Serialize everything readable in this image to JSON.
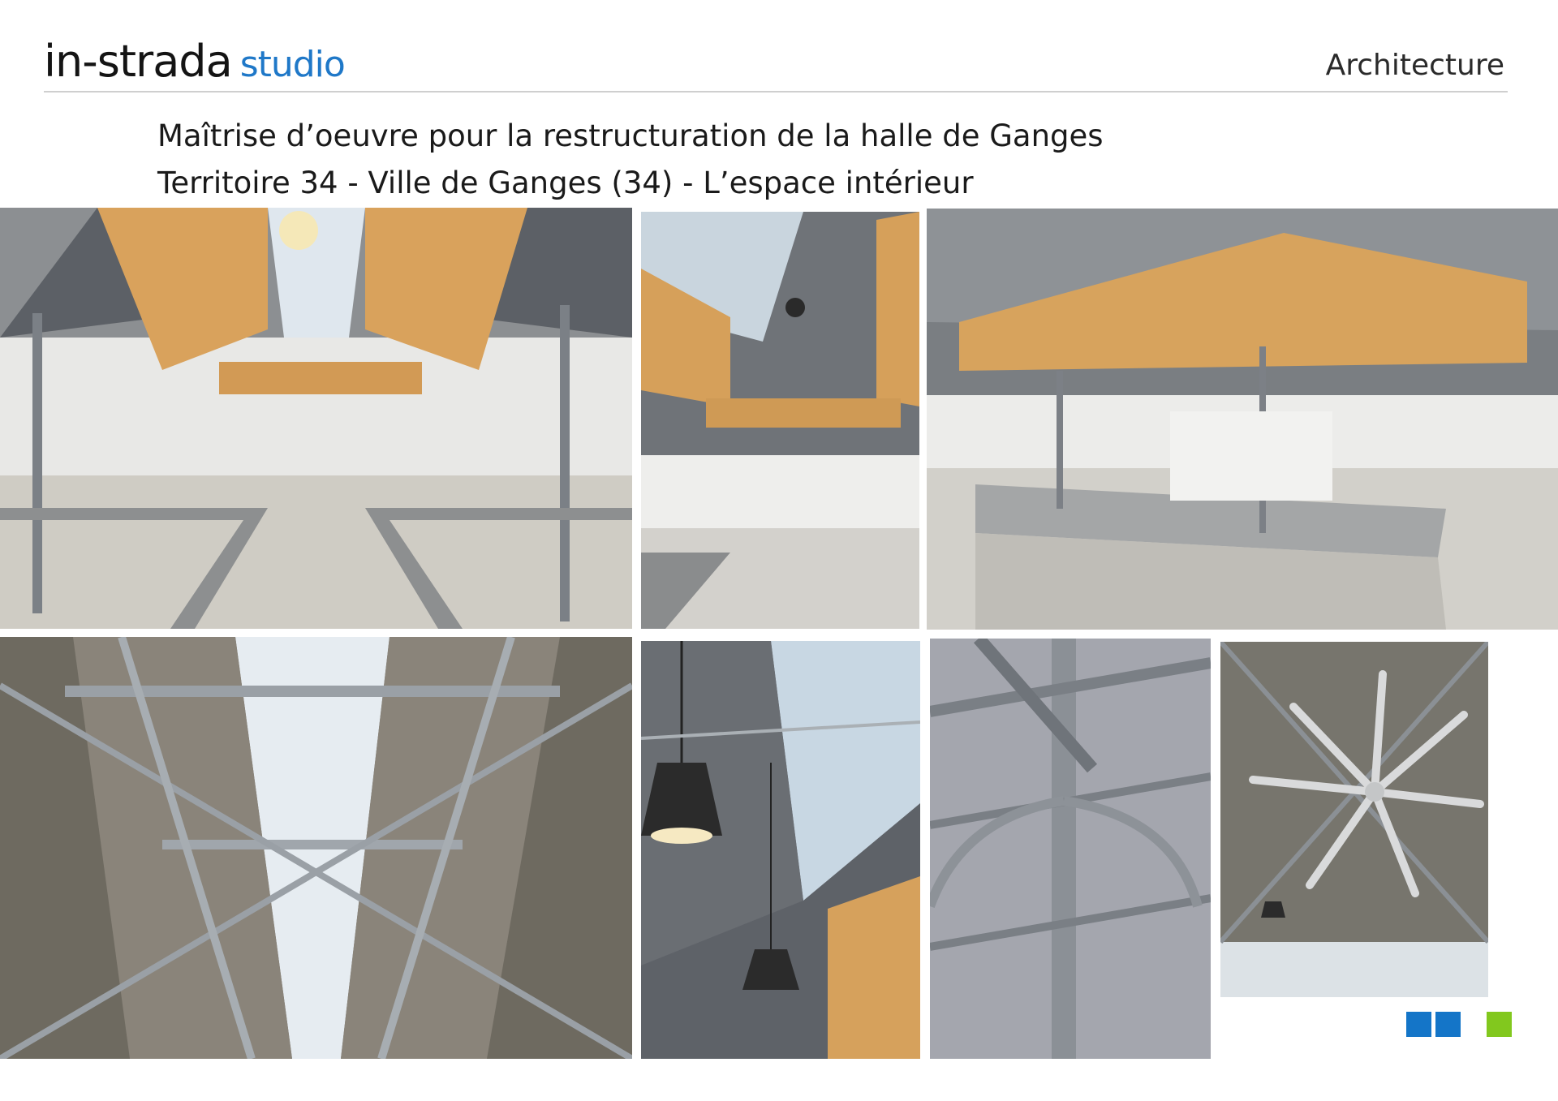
{
  "header": {
    "brand": "in-strada",
    "brand_suffix": "studio",
    "section": "Architecture"
  },
  "project": {
    "title_line1": "Maîtrise d’oeuvre pour la restructuration de la halle de Ganges",
    "title_line2": "Territoire 34 - Ville de Ganges (34) - L’espace intérieur"
  },
  "colors": {
    "brand_blue": "#1f78c8",
    "square_blue": "#1475c8",
    "square_green": "#82c81e"
  }
}
